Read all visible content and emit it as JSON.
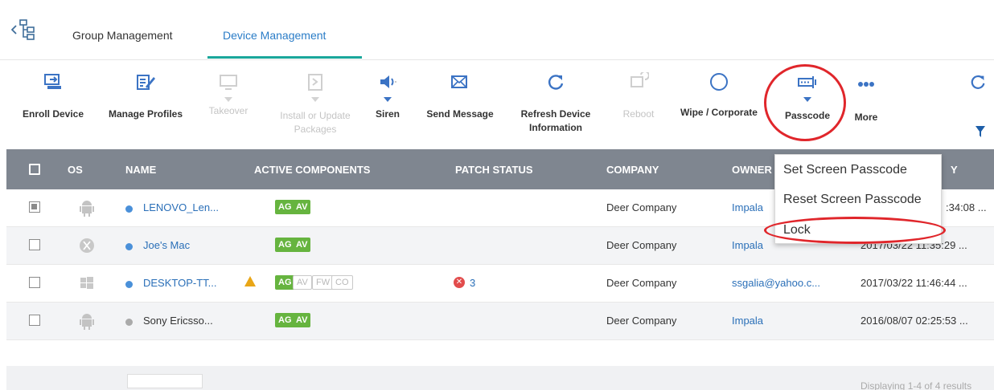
{
  "tabs": [
    {
      "label": "Group Management",
      "active": false
    },
    {
      "label": "Device Management",
      "active": true
    }
  ],
  "toolbar": {
    "enroll": "Enroll Device",
    "manage_profiles": "Manage Profiles",
    "takeover": "Takeover",
    "install_line1": "Install or Update",
    "install_line2": "Packages",
    "siren": "Siren",
    "send_message": "Send Message",
    "refresh_line1": "Refresh Device",
    "refresh_line2": "Information",
    "reboot": "Reboot",
    "wipe": "Wipe / Corporate",
    "passcode": "Passcode",
    "more": "More"
  },
  "table": {
    "headers": {
      "os": "OS",
      "name": "NAME",
      "active_components": "ACTIVE COMPONENTS",
      "patch_status": "PATCH STATUS",
      "company": "COMPANY",
      "owner": "OWNER",
      "last_activity_tail": "Y"
    },
    "rows": [
      {
        "name": "LENOVO_Len...",
        "components": [
          "AG",
          "AV"
        ],
        "patch": "",
        "company": "Deer Company",
        "owner": "Impala",
        "date": ":34:08 ..."
      },
      {
        "name": "Joe's Mac",
        "components": [
          "AG",
          "AV"
        ],
        "patch": "",
        "company": "Deer Company",
        "owner": "Impala",
        "date": "2017/03/22 11:35:29 ..."
      },
      {
        "name": "DESKTOP-TT...",
        "components": [
          "AG",
          "AV",
          "FW",
          "CO"
        ],
        "patch": "3",
        "company": "Deer Company",
        "owner": "ssgalia@yahoo.c...",
        "date": "2017/03/22 11:46:44 ..."
      },
      {
        "name": "Sony Ericsso...",
        "components": [
          "AG",
          "AV"
        ],
        "patch": "",
        "company": "Deer Company",
        "owner": "Impala",
        "date": "2016/08/07 02:25:53 ..."
      }
    ]
  },
  "dropdown": {
    "items": [
      "Set Screen Passcode",
      "Reset Screen Passcode",
      "Lock"
    ]
  },
  "footer": {
    "text": "Displaying 1-4 of 4 results"
  },
  "colors": {
    "accent": "#2a7cc7",
    "header_bg": "#7f8690",
    "badge_green": "#66b43f",
    "highlight_red": "#e0262b"
  }
}
